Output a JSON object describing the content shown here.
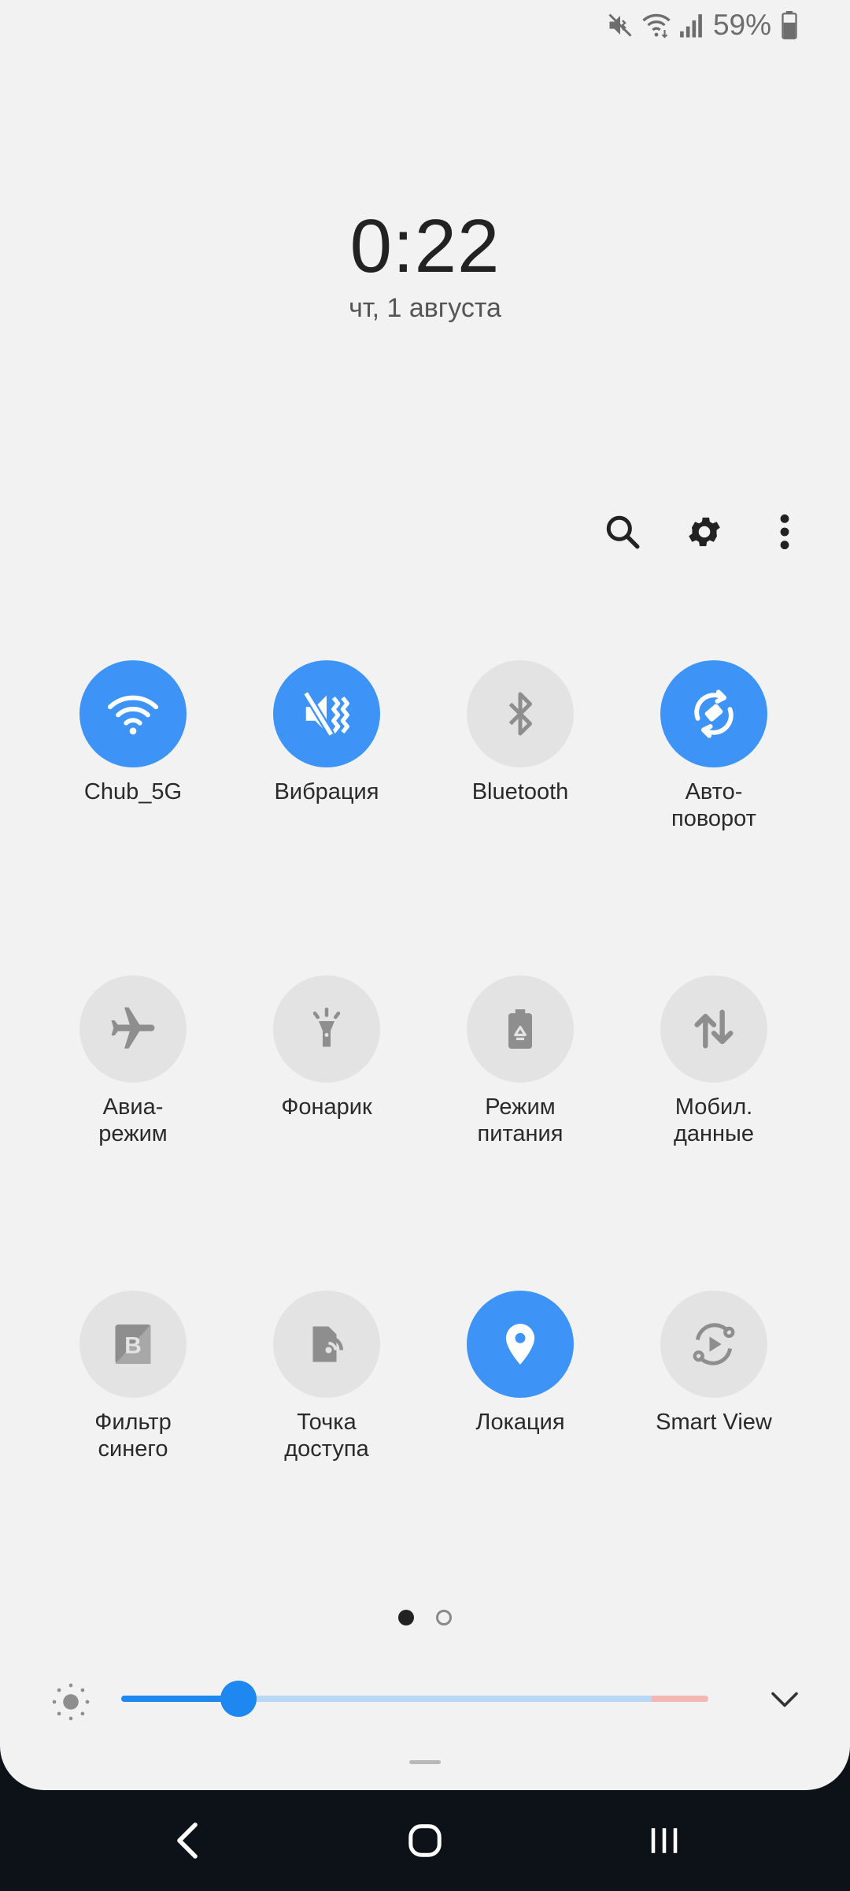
{
  "status_bar": {
    "battery_percent": "59%",
    "icons": [
      "mute-icon",
      "wifi-icon",
      "signal-icon",
      "battery-icon"
    ]
  },
  "clock": {
    "time": "0:22",
    "date": "чт, 1 августа"
  },
  "toolbar": {
    "icons": [
      "search-icon",
      "gear-icon",
      "more-vert-icon"
    ]
  },
  "accent_color": "#3e94f6",
  "tiles": [
    {
      "label": "Chub_5G",
      "icon": "wifi-icon",
      "active": true
    },
    {
      "label": "Вибрация",
      "icon": "vibrate-icon",
      "active": true
    },
    {
      "label": "Bluetooth",
      "icon": "bluetooth-icon",
      "active": false
    },
    {
      "label": "Авто-\nповорот",
      "icon": "auto-rotate-icon",
      "active": true
    },
    {
      "label": "Авиа-\nрежим",
      "icon": "airplane-icon",
      "active": false
    },
    {
      "label": "Фонарик",
      "icon": "flashlight-icon",
      "active": false
    },
    {
      "label": "Режим\nпитания",
      "icon": "power-mode-icon",
      "active": false
    },
    {
      "label": "Мобил.\nданные",
      "icon": "mobile-data-icon",
      "active": false
    },
    {
      "label": "Фильтр\nсинего",
      "icon": "blue-filter-icon",
      "active": false
    },
    {
      "label": "Точка\nдоступа",
      "icon": "hotspot-icon",
      "active": false
    },
    {
      "label": "Локация",
      "icon": "location-icon",
      "active": true
    },
    {
      "label": "Smart View",
      "icon": "smart-view-icon",
      "active": false
    }
  ],
  "pagination": {
    "current": 1,
    "total": 2
  },
  "brightness": {
    "level": 0.2
  },
  "navigation": {
    "buttons": [
      "back-icon",
      "home-icon",
      "recents-icon"
    ]
  }
}
